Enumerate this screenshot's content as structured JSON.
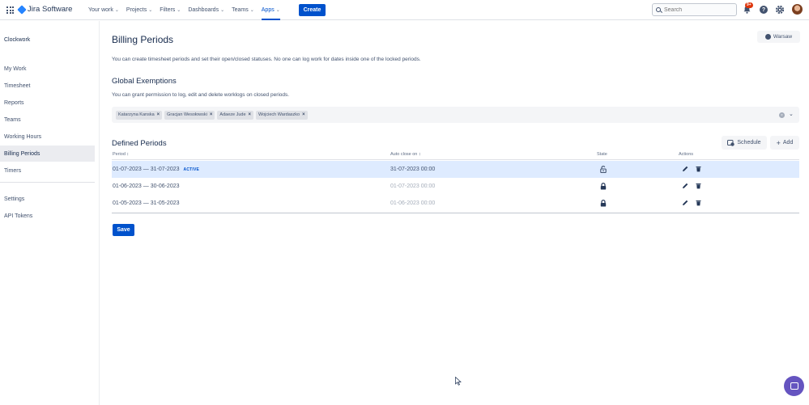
{
  "topnav": {
    "product": "Jira Software",
    "items": [
      {
        "label": "Your work"
      },
      {
        "label": "Projects"
      },
      {
        "label": "Filters"
      },
      {
        "label": "Dashboards"
      },
      {
        "label": "Teams"
      },
      {
        "label": "Apps"
      }
    ],
    "active_item": "Apps",
    "create_label": "Create",
    "search_placeholder": "Search",
    "notification_badge": "9+"
  },
  "sidebar": {
    "title": "Clockwork",
    "items": [
      {
        "label": "My Work"
      },
      {
        "label": "Timesheet"
      },
      {
        "label": "Reports"
      },
      {
        "label": "Teams"
      },
      {
        "label": "Working Hours"
      },
      {
        "label": "Billing Periods"
      },
      {
        "label": "Timers"
      },
      {
        "label": "Settings"
      },
      {
        "label": "API Tokens"
      }
    ],
    "selected": "Billing Periods"
  },
  "main": {
    "title": "Billing Periods",
    "timezone_label": "Warsaw",
    "description": "You can create timesheet periods and set their open/closed statuses. No one can log work for dates inside one of the locked periods.",
    "exemptions": {
      "heading": "Global Exemptions",
      "description": "You can grant permission to log, edit and delete worklogs on closed periods.",
      "users": [
        "Katarzyna Kanska",
        "Gracjan Wesołowski",
        "Adaeze Jude",
        "Wojciech Wardaszko"
      ]
    },
    "periods": {
      "heading": "Defined Periods",
      "schedule_label": "Schedule",
      "add_label": "Add",
      "columns": {
        "period": "Period ↕",
        "auto_close": "Auto close on ↕",
        "state": "State",
        "actions": "Actions"
      },
      "rows": [
        {
          "period": "01-07-2023 — 31-07-2023",
          "badge": "ACTIVE",
          "auto_close": "31-07-2023 00:00",
          "state": "unlocked"
        },
        {
          "period": "01-06-2023 — 30-06-2023",
          "badge": "",
          "auto_close": "01-07-2023 00:00",
          "state": "locked"
        },
        {
          "period": "01-05-2023 — 31-05-2023",
          "badge": "",
          "auto_close": "01-06-2023 00:00",
          "state": "locked"
        }
      ]
    },
    "save_label": "Save"
  },
  "colors": {
    "primary": "#0052cc",
    "active_row": "#deebff",
    "chat": "#6554c0",
    "badge": "#de350b"
  }
}
